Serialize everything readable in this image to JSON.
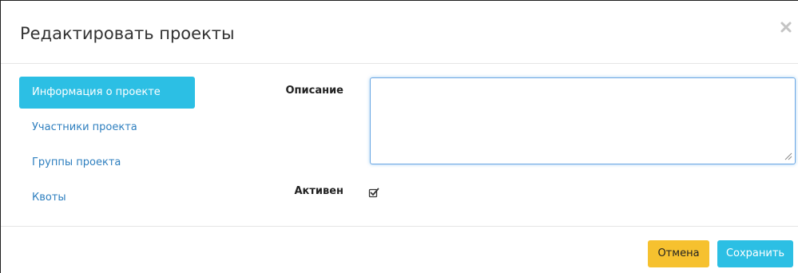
{
  "modal": {
    "title": "Редактировать проекты"
  },
  "nav": {
    "items": [
      {
        "label": "Информация о проекте",
        "active": true
      },
      {
        "label": "Участники проекта",
        "active": false
      },
      {
        "label": "Группы проекта",
        "active": false
      },
      {
        "label": "Квоты",
        "active": false
      }
    ]
  },
  "form": {
    "description_label": "Описание",
    "description_value": "",
    "active_label": "Активен",
    "active_checked": true
  },
  "footer": {
    "cancel_label": "Отмена",
    "save_label": "Сохранить"
  },
  "icons": {
    "close": "close-icon",
    "checkbox": "checkbox-checked-icon",
    "resize": "resize-grip-icon"
  },
  "colors": {
    "primary": "#2cbfe4",
    "warning": "#f6c12f",
    "link": "#2e7fbf"
  }
}
